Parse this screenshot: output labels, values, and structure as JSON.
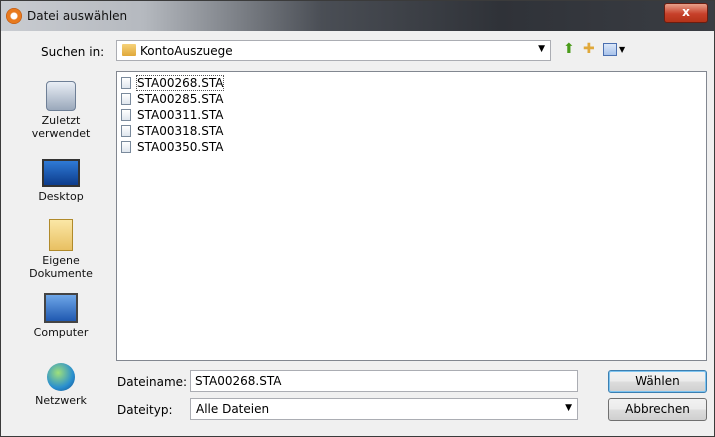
{
  "window": {
    "title": "Datei auswählen",
    "close_label": "x"
  },
  "lookin": {
    "label": "Suchen in:",
    "value": "KontoAuszuege"
  },
  "toolbar": {
    "up_icon": "up-folder-icon",
    "newfolder_icon": "new-folder-icon",
    "view_icon": "view-menu-icon"
  },
  "places": [
    {
      "label": "Zuletzt verwendet",
      "icon": "recent-places-icon"
    },
    {
      "label": "Desktop",
      "icon": "desktop-icon"
    },
    {
      "label": "Eigene Dokumente",
      "icon": "documents-icon"
    },
    {
      "label": "Computer",
      "icon": "computer-icon"
    },
    {
      "label": "Netzwerk",
      "icon": "network-icon"
    }
  ],
  "files": [
    {
      "name": "STA00268.STA",
      "selected": true
    },
    {
      "name": "STA00285.STA",
      "selected": false
    },
    {
      "name": "STA00311.STA",
      "selected": false
    },
    {
      "name": "STA00318.STA",
      "selected": false
    },
    {
      "name": "STA00350.STA",
      "selected": false
    }
  ],
  "filename": {
    "label": "Dateiname:",
    "value": "STA00268.STA"
  },
  "filetype": {
    "label": "Dateityp:",
    "value": "Alle Dateien"
  },
  "buttons": {
    "ok": "Wählen",
    "cancel": "Abbrechen"
  },
  "colors": {
    "accent": "#3c7fb1",
    "close": "#c7402a"
  }
}
